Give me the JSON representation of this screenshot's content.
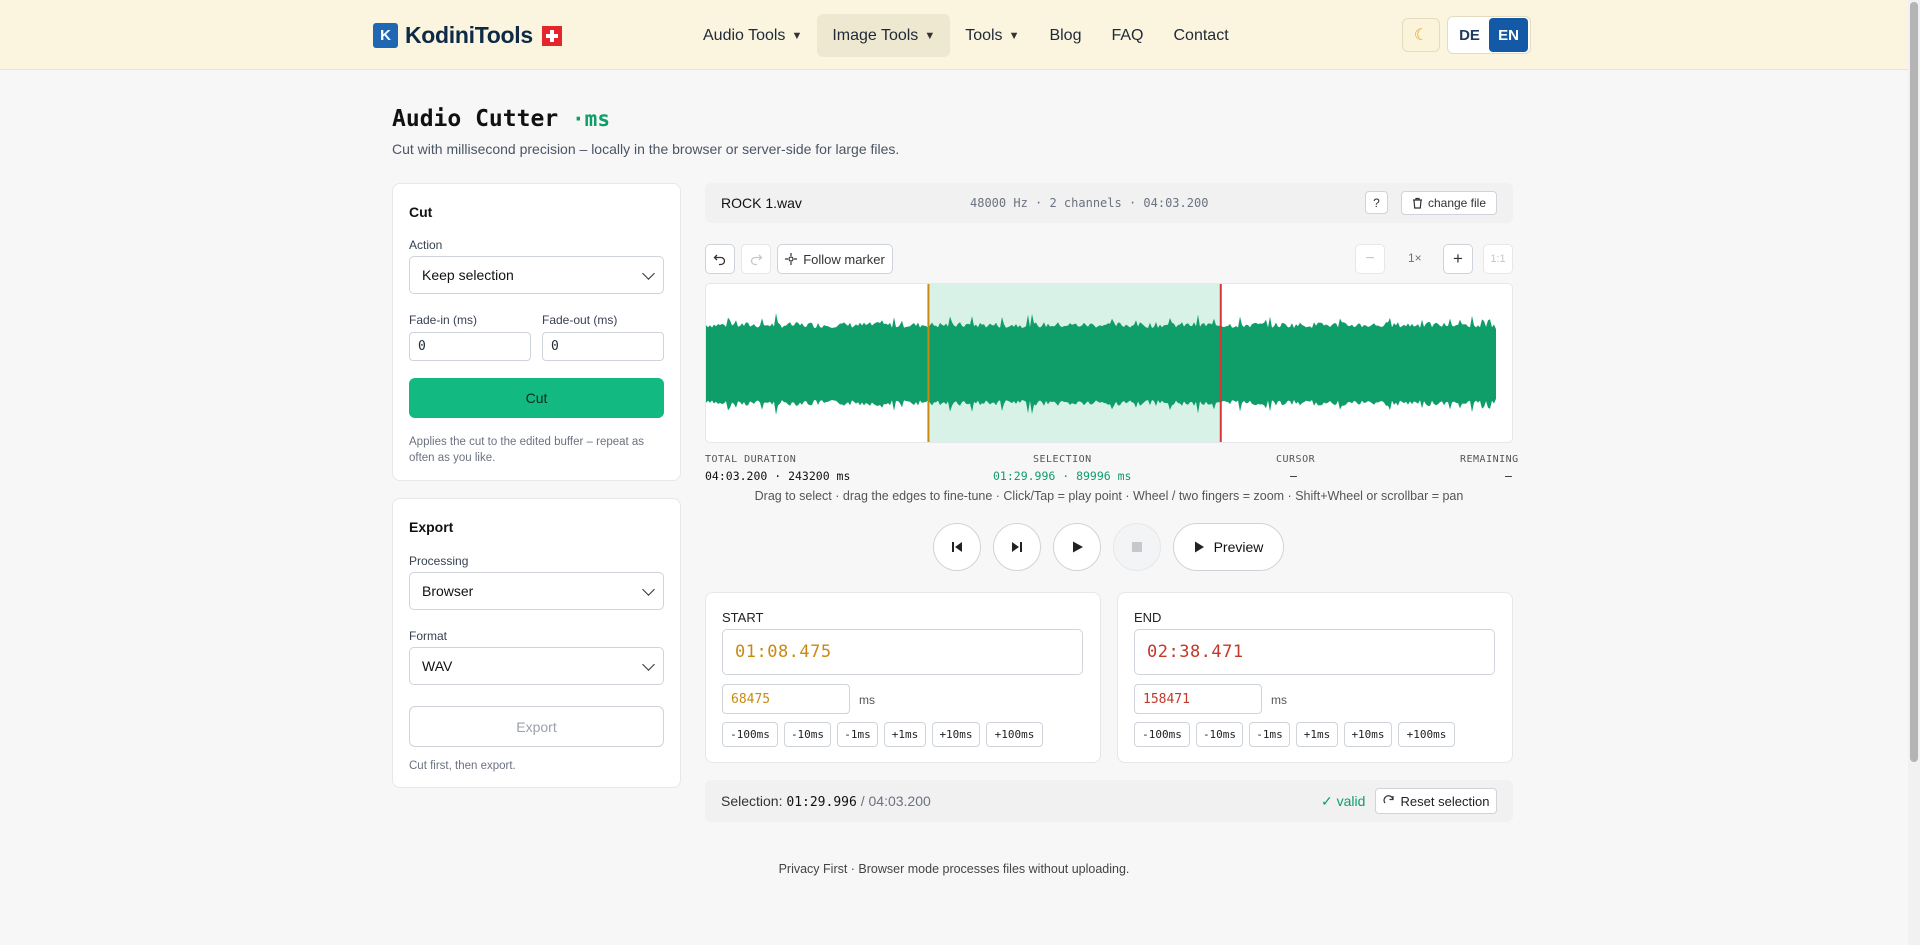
{
  "header": {
    "logo_text": "KodiniTools",
    "nav": [
      {
        "label": "Audio Tools",
        "dropdown": true
      },
      {
        "label": "Image Tools",
        "dropdown": true
      },
      {
        "label": "Tools",
        "dropdown": true
      },
      {
        "label": "Blog",
        "dropdown": false
      },
      {
        "label": "FAQ",
        "dropdown": false
      },
      {
        "label": "Contact",
        "dropdown": false
      }
    ],
    "theme_icon": "moon-icon",
    "lang_de": "DE",
    "lang_en": "EN"
  },
  "page": {
    "title": "Audio Cutter",
    "title_suffix": "·ms",
    "subtitle": "Cut with millisecond precision – locally in the browser or server-side for large files."
  },
  "cut_card": {
    "title": "Cut",
    "action_label": "Action",
    "action_value": "Keep selection",
    "fade_in_label": "Fade-in (ms)",
    "fade_in_value": "0",
    "fade_out_label": "Fade-out (ms)",
    "fade_out_value": "0",
    "cut_button": "Cut",
    "note": "Applies the cut to the edited buffer – repeat as often as you like."
  },
  "export_card": {
    "title": "Export",
    "processing_label": "Processing",
    "processing_value": "Browser",
    "format_label": "Format",
    "format_value": "WAV",
    "export_button": "Export",
    "note": "Cut first, then export."
  },
  "file": {
    "name": "ROCK 1.wav",
    "info": "48000 Hz · 2 channels · 04:03.200",
    "help": "?",
    "change": "change file"
  },
  "toolbar": {
    "follow_marker": "Follow marker",
    "zoom_minus": "−",
    "zoom_level": "1×",
    "zoom_plus": "+",
    "zoom_reset": "1:1"
  },
  "waveform": {
    "color": "#0f9d6a",
    "selection_color": "#d9f2e8",
    "start_marker_color": "#c98a12",
    "end_marker_color": "#d9343a",
    "duration_ms": 243200,
    "selection_start_ms": 68475,
    "selection_end_ms": 158471
  },
  "stats": {
    "total_label": "TOTAL DURATION",
    "total_value": "04:03.200 · 243200 ms",
    "selection_label": "SELECTION",
    "selection_value": "01:29.996 · 89996 ms",
    "cursor_label": "CURSOR",
    "cursor_value": "–",
    "remaining_label": "REMAINING",
    "remaining_value": "–"
  },
  "hint": "Drag to select · drag the edges to fine-tune · Click/Tap = play point · Wheel / two fingers = zoom · Shift+Wheel or scrollbar = pan",
  "transport": {
    "preview_label": "Preview"
  },
  "start": {
    "label": "START",
    "time": "01:08.475",
    "ms": "68475",
    "unit": "ms",
    "color": "#c98a12"
  },
  "end": {
    "label": "END",
    "time": "02:38.471",
    "ms": "158471",
    "unit": "ms",
    "color": "#c0392b"
  },
  "steps": [
    "-100ms",
    "-10ms",
    "-1ms",
    "+1ms",
    "+10ms",
    "+100ms"
  ],
  "selection_bar": {
    "prefix": "Selection:",
    "duration": "01:29.996",
    "total": "/ 04:03.200",
    "valid": "✓ valid",
    "reset": "Reset selection"
  },
  "footer": "Privacy First · Browser mode processes files without uploading."
}
